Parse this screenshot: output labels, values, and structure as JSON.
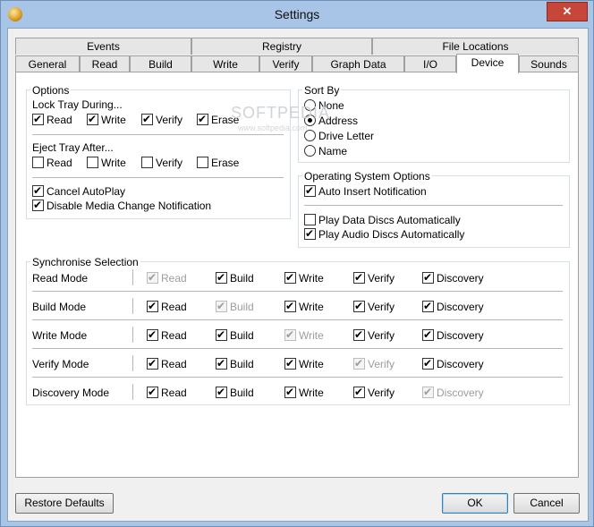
{
  "window": {
    "title": "Settings",
    "close_glyph": "✕"
  },
  "tabs_row1": [
    "Events",
    "Registry",
    "File Locations"
  ],
  "tabs_row2": [
    "General",
    "Read",
    "Build",
    "Write",
    "Verify",
    "Graph Data",
    "I/O",
    "Device",
    "Sounds"
  ],
  "active_tab": "Device",
  "options": {
    "title": "Options",
    "lock_tray_label": "Lock Tray During...",
    "lock_tray": [
      {
        "label": "Read",
        "checked": true
      },
      {
        "label": "Write",
        "checked": true
      },
      {
        "label": "Verify",
        "checked": true
      },
      {
        "label": "Erase",
        "checked": true
      }
    ],
    "eject_tray_label": "Eject Tray After...",
    "eject_tray": [
      {
        "label": "Read",
        "checked": false
      },
      {
        "label": "Write",
        "checked": false
      },
      {
        "label": "Verify",
        "checked": false
      },
      {
        "label": "Erase",
        "checked": false
      }
    ],
    "cancel_autoplay": {
      "label": "Cancel AutoPlay",
      "checked": true
    },
    "disable_media_change": {
      "label": "Disable Media Change Notification",
      "checked": true
    }
  },
  "sort_by": {
    "title": "Sort By",
    "options": [
      {
        "label": "None",
        "selected": false
      },
      {
        "label": "Address",
        "selected": true
      },
      {
        "label": "Drive Letter",
        "selected": false
      },
      {
        "label": "Name",
        "selected": false
      }
    ]
  },
  "os_options": {
    "title": "Operating System Options",
    "auto_insert": {
      "label": "Auto Insert Notification",
      "checked": true
    },
    "play_data": {
      "label": "Play Data Discs Automatically",
      "checked": false
    },
    "play_audio": {
      "label": "Play Audio Discs Automatically",
      "checked": true
    }
  },
  "sync": {
    "title": "Synchronise Selection",
    "columns": [
      "Read",
      "Build",
      "Write",
      "Verify",
      "Discovery"
    ],
    "rows": [
      {
        "label": "Read Mode",
        "disabled_col": 0
      },
      {
        "label": "Build Mode",
        "disabled_col": 1
      },
      {
        "label": "Write Mode",
        "disabled_col": 2
      },
      {
        "label": "Verify Mode",
        "disabled_col": 3
      },
      {
        "label": "Discovery Mode",
        "disabled_col": 4
      }
    ]
  },
  "buttons": {
    "restore": "Restore Defaults",
    "ok": "OK",
    "cancel": "Cancel"
  },
  "watermark": {
    "main": "SOFTPEDIA",
    "sub": "www.softpedia.com"
  }
}
